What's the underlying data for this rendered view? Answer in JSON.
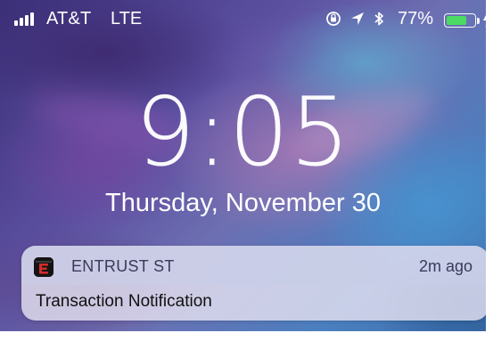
{
  "status_bar": {
    "carrier": "AT&T",
    "network": "LTE",
    "signal_bars_filled": 4,
    "battery_percent": "77%",
    "battery_level": 0.77,
    "icons": [
      "orientation-lock-icon",
      "location-icon",
      "bluetooth-icon",
      "battery-icon",
      "charging-icon"
    ],
    "battery_color": "#4cd964"
  },
  "lock_screen": {
    "time": "9:05",
    "date": "Thursday, November 30"
  },
  "notification": {
    "app_name": "ENTRUST ST",
    "time_ago": "2m ago",
    "body": "Transaction Notification",
    "app_icon": "entrust-e-icon",
    "app_icon_colors": [
      "#141414",
      "#d42b2b"
    ]
  }
}
